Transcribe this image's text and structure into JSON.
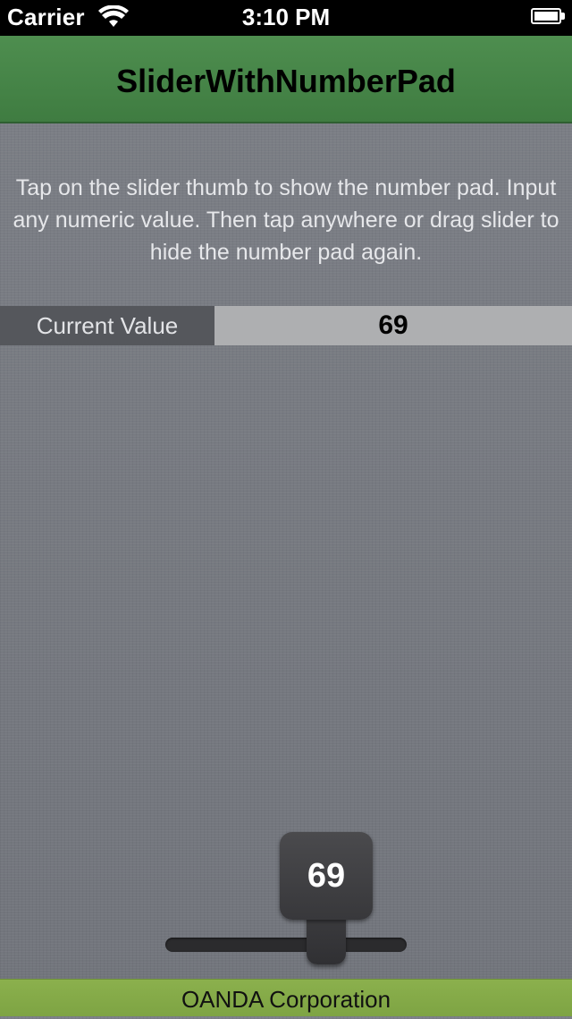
{
  "status_bar": {
    "carrier": "Carrier",
    "time": "3:10 PM",
    "wifi_icon": "wifi-icon",
    "battery_icon": "battery-full-icon"
  },
  "nav_bar": {
    "title": "SliderWithNumberPad",
    "color": "#4a884b"
  },
  "instructions": "Tap on the slider thumb to show the number pad. Input any numeric value. Then tap anywhere or drag slider to hide the number pad again.",
  "current_value": {
    "label": "Current Value",
    "value": "69"
  },
  "slider": {
    "value": "69",
    "thumb_icon": "slider-thumb-icon"
  },
  "footer": {
    "text": "OANDA Corporation",
    "color": "#88ad4a"
  }
}
